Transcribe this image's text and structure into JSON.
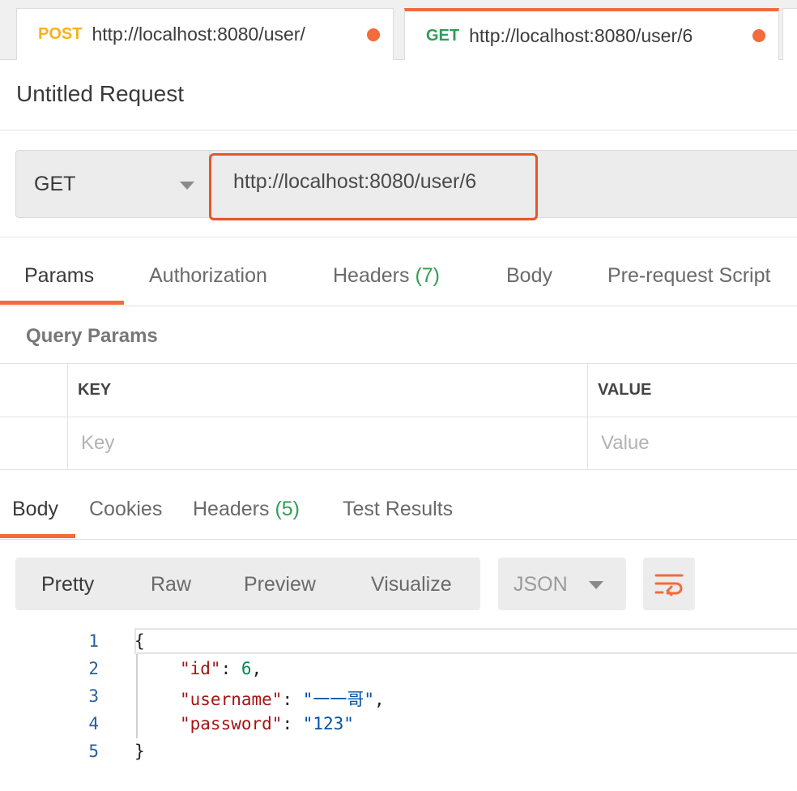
{
  "tabs": [
    {
      "method": "POST",
      "url": "http://localhost:8080/user/"
    },
    {
      "method": "GET",
      "url": "http://localhost:8080/user/6"
    }
  ],
  "request": {
    "title": "Untitled Request",
    "method": "GET",
    "url": "http://localhost:8080/user/6"
  },
  "request_tabs": {
    "params": "Params",
    "authorization": "Authorization",
    "headers": "Headers",
    "headers_count": "(7)",
    "body": "Body",
    "prerequest": "Pre-request Script"
  },
  "query_params": {
    "label": "Query Params",
    "key_header": "KEY",
    "value_header": "VALUE",
    "key_placeholder": "Key",
    "value_placeholder": "Value"
  },
  "response_tabs": {
    "body": "Body",
    "cookies": "Cookies",
    "headers": "Headers",
    "headers_count": "(5)",
    "tests": "Test Results"
  },
  "view": {
    "pretty": "Pretty",
    "raw": "Raw",
    "preview": "Preview",
    "visualize": "Visualize",
    "format": "JSON",
    "wrap_icon": "wrap-lines-icon"
  },
  "response_body": {
    "line_numbers": [
      "1",
      "2",
      "3",
      "4",
      "5"
    ],
    "open_brace": "{",
    "close_brace": "}",
    "lines": [
      {
        "key": "\"id\"",
        "sep": ": ",
        "value": "6",
        "trail": ","
      },
      {
        "key": "\"username\"",
        "sep": ": ",
        "value": "\"一一哥\"",
        "trail": ","
      },
      {
        "key": "\"password\"",
        "sep": ": ",
        "value": "\"123\"",
        "trail": ""
      }
    ]
  },
  "colors": {
    "accent": "#f26b3a",
    "get": "#2f9e57",
    "post": "#fbb117",
    "url_highlight": "#e8552b"
  }
}
